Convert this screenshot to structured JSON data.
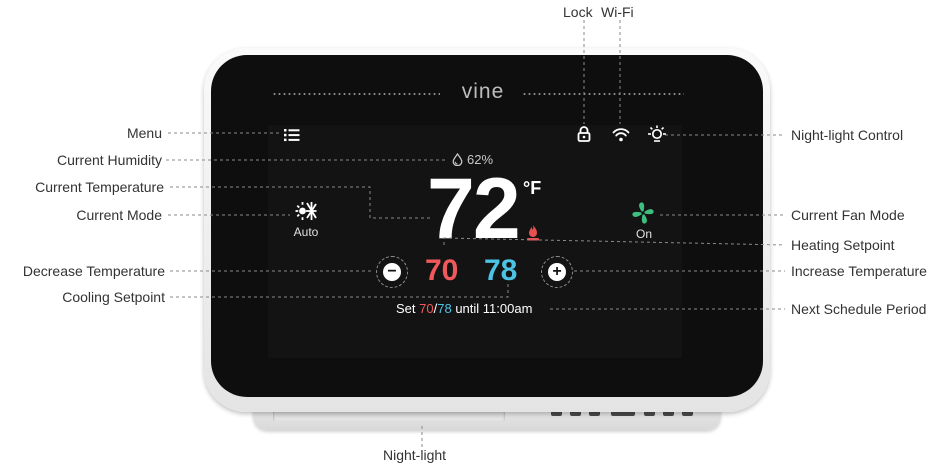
{
  "device": {
    "brand": "vine",
    "current_temperature": "72",
    "temperature_unit": "°F",
    "humidity": "62%",
    "mode_label": "Auto",
    "fan_label": "On",
    "heating_setpoint": "70",
    "cooling_setpoint": "78",
    "decrease_glyph": "−",
    "increase_glyph": "+",
    "schedule": {
      "prefix": "Set",
      "heat": "70",
      "separator": "/",
      "cool": "78",
      "suffix": "until 11:00am"
    },
    "colors": {
      "heat": "#f0595c",
      "cool": "#4cc2e4",
      "fan": "#3fbf7f",
      "flame": "#e8514f"
    },
    "icons": [
      "menu-icon",
      "humidity-drop-icon",
      "mode-sun-snow-icon",
      "fan-icon",
      "flame-icon",
      "lock-icon",
      "wifi-icon",
      "night-light-icon"
    ]
  },
  "callouts": {
    "lock": "Lock",
    "wifi": "Wi-Fi",
    "menu": "Menu",
    "current_humidity": "Current Humidity",
    "current_temperature": "Current Temperature",
    "current_mode": "Current Mode",
    "decrease_temperature": "Decrease Temperature",
    "cooling_setpoint": "Cooling Setpoint",
    "night_light_control": "Night-light Control",
    "current_fan_mode": "Current Fan Mode",
    "heating_setpoint": "Heating Setpoint",
    "increase_temperature": "Increase Temperature",
    "next_schedule_period": "Next Schedule Period",
    "night_light": "Night-light"
  }
}
